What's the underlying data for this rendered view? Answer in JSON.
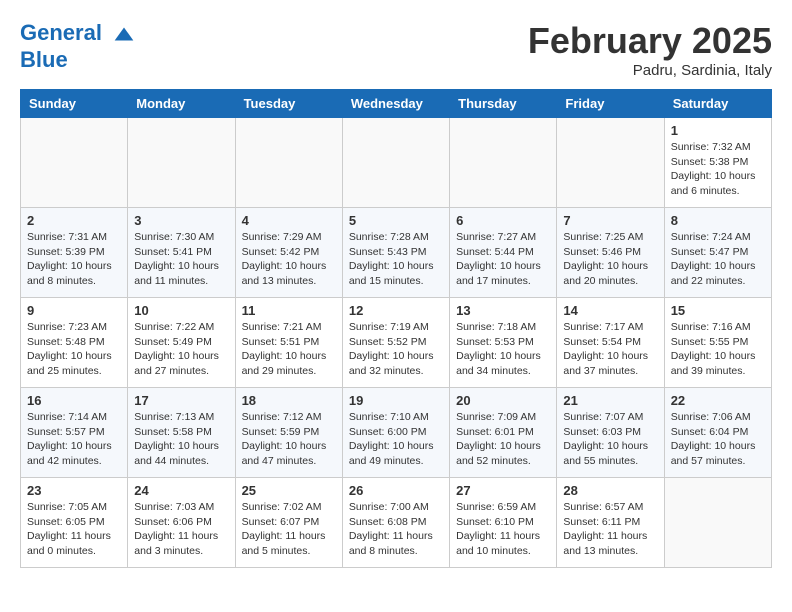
{
  "header": {
    "logo_line1": "General",
    "logo_line2": "Blue",
    "month_title": "February 2025",
    "location": "Padru, Sardinia, Italy"
  },
  "weekdays": [
    "Sunday",
    "Monday",
    "Tuesday",
    "Wednesday",
    "Thursday",
    "Friday",
    "Saturday"
  ],
  "weeks": [
    [
      {
        "day": "",
        "info": ""
      },
      {
        "day": "",
        "info": ""
      },
      {
        "day": "",
        "info": ""
      },
      {
        "day": "",
        "info": ""
      },
      {
        "day": "",
        "info": ""
      },
      {
        "day": "",
        "info": ""
      },
      {
        "day": "1",
        "info": "Sunrise: 7:32 AM\nSunset: 5:38 PM\nDaylight: 10 hours\nand 6 minutes."
      }
    ],
    [
      {
        "day": "2",
        "info": "Sunrise: 7:31 AM\nSunset: 5:39 PM\nDaylight: 10 hours\nand 8 minutes."
      },
      {
        "day": "3",
        "info": "Sunrise: 7:30 AM\nSunset: 5:41 PM\nDaylight: 10 hours\nand 11 minutes."
      },
      {
        "day": "4",
        "info": "Sunrise: 7:29 AM\nSunset: 5:42 PM\nDaylight: 10 hours\nand 13 minutes."
      },
      {
        "day": "5",
        "info": "Sunrise: 7:28 AM\nSunset: 5:43 PM\nDaylight: 10 hours\nand 15 minutes."
      },
      {
        "day": "6",
        "info": "Sunrise: 7:27 AM\nSunset: 5:44 PM\nDaylight: 10 hours\nand 17 minutes."
      },
      {
        "day": "7",
        "info": "Sunrise: 7:25 AM\nSunset: 5:46 PM\nDaylight: 10 hours\nand 20 minutes."
      },
      {
        "day": "8",
        "info": "Sunrise: 7:24 AM\nSunset: 5:47 PM\nDaylight: 10 hours\nand 22 minutes."
      }
    ],
    [
      {
        "day": "9",
        "info": "Sunrise: 7:23 AM\nSunset: 5:48 PM\nDaylight: 10 hours\nand 25 minutes."
      },
      {
        "day": "10",
        "info": "Sunrise: 7:22 AM\nSunset: 5:49 PM\nDaylight: 10 hours\nand 27 minutes."
      },
      {
        "day": "11",
        "info": "Sunrise: 7:21 AM\nSunset: 5:51 PM\nDaylight: 10 hours\nand 29 minutes."
      },
      {
        "day": "12",
        "info": "Sunrise: 7:19 AM\nSunset: 5:52 PM\nDaylight: 10 hours\nand 32 minutes."
      },
      {
        "day": "13",
        "info": "Sunrise: 7:18 AM\nSunset: 5:53 PM\nDaylight: 10 hours\nand 34 minutes."
      },
      {
        "day": "14",
        "info": "Sunrise: 7:17 AM\nSunset: 5:54 PM\nDaylight: 10 hours\nand 37 minutes."
      },
      {
        "day": "15",
        "info": "Sunrise: 7:16 AM\nSunset: 5:55 PM\nDaylight: 10 hours\nand 39 minutes."
      }
    ],
    [
      {
        "day": "16",
        "info": "Sunrise: 7:14 AM\nSunset: 5:57 PM\nDaylight: 10 hours\nand 42 minutes."
      },
      {
        "day": "17",
        "info": "Sunrise: 7:13 AM\nSunset: 5:58 PM\nDaylight: 10 hours\nand 44 minutes."
      },
      {
        "day": "18",
        "info": "Sunrise: 7:12 AM\nSunset: 5:59 PM\nDaylight: 10 hours\nand 47 minutes."
      },
      {
        "day": "19",
        "info": "Sunrise: 7:10 AM\nSunset: 6:00 PM\nDaylight: 10 hours\nand 49 minutes."
      },
      {
        "day": "20",
        "info": "Sunrise: 7:09 AM\nSunset: 6:01 PM\nDaylight: 10 hours\nand 52 minutes."
      },
      {
        "day": "21",
        "info": "Sunrise: 7:07 AM\nSunset: 6:03 PM\nDaylight: 10 hours\nand 55 minutes."
      },
      {
        "day": "22",
        "info": "Sunrise: 7:06 AM\nSunset: 6:04 PM\nDaylight: 10 hours\nand 57 minutes."
      }
    ],
    [
      {
        "day": "23",
        "info": "Sunrise: 7:05 AM\nSunset: 6:05 PM\nDaylight: 11 hours\nand 0 minutes."
      },
      {
        "day": "24",
        "info": "Sunrise: 7:03 AM\nSunset: 6:06 PM\nDaylight: 11 hours\nand 3 minutes."
      },
      {
        "day": "25",
        "info": "Sunrise: 7:02 AM\nSunset: 6:07 PM\nDaylight: 11 hours\nand 5 minutes."
      },
      {
        "day": "26",
        "info": "Sunrise: 7:00 AM\nSunset: 6:08 PM\nDaylight: 11 hours\nand 8 minutes."
      },
      {
        "day": "27",
        "info": "Sunrise: 6:59 AM\nSunset: 6:10 PM\nDaylight: 11 hours\nand 10 minutes."
      },
      {
        "day": "28",
        "info": "Sunrise: 6:57 AM\nSunset: 6:11 PM\nDaylight: 11 hours\nand 13 minutes."
      },
      {
        "day": "",
        "info": ""
      }
    ]
  ]
}
